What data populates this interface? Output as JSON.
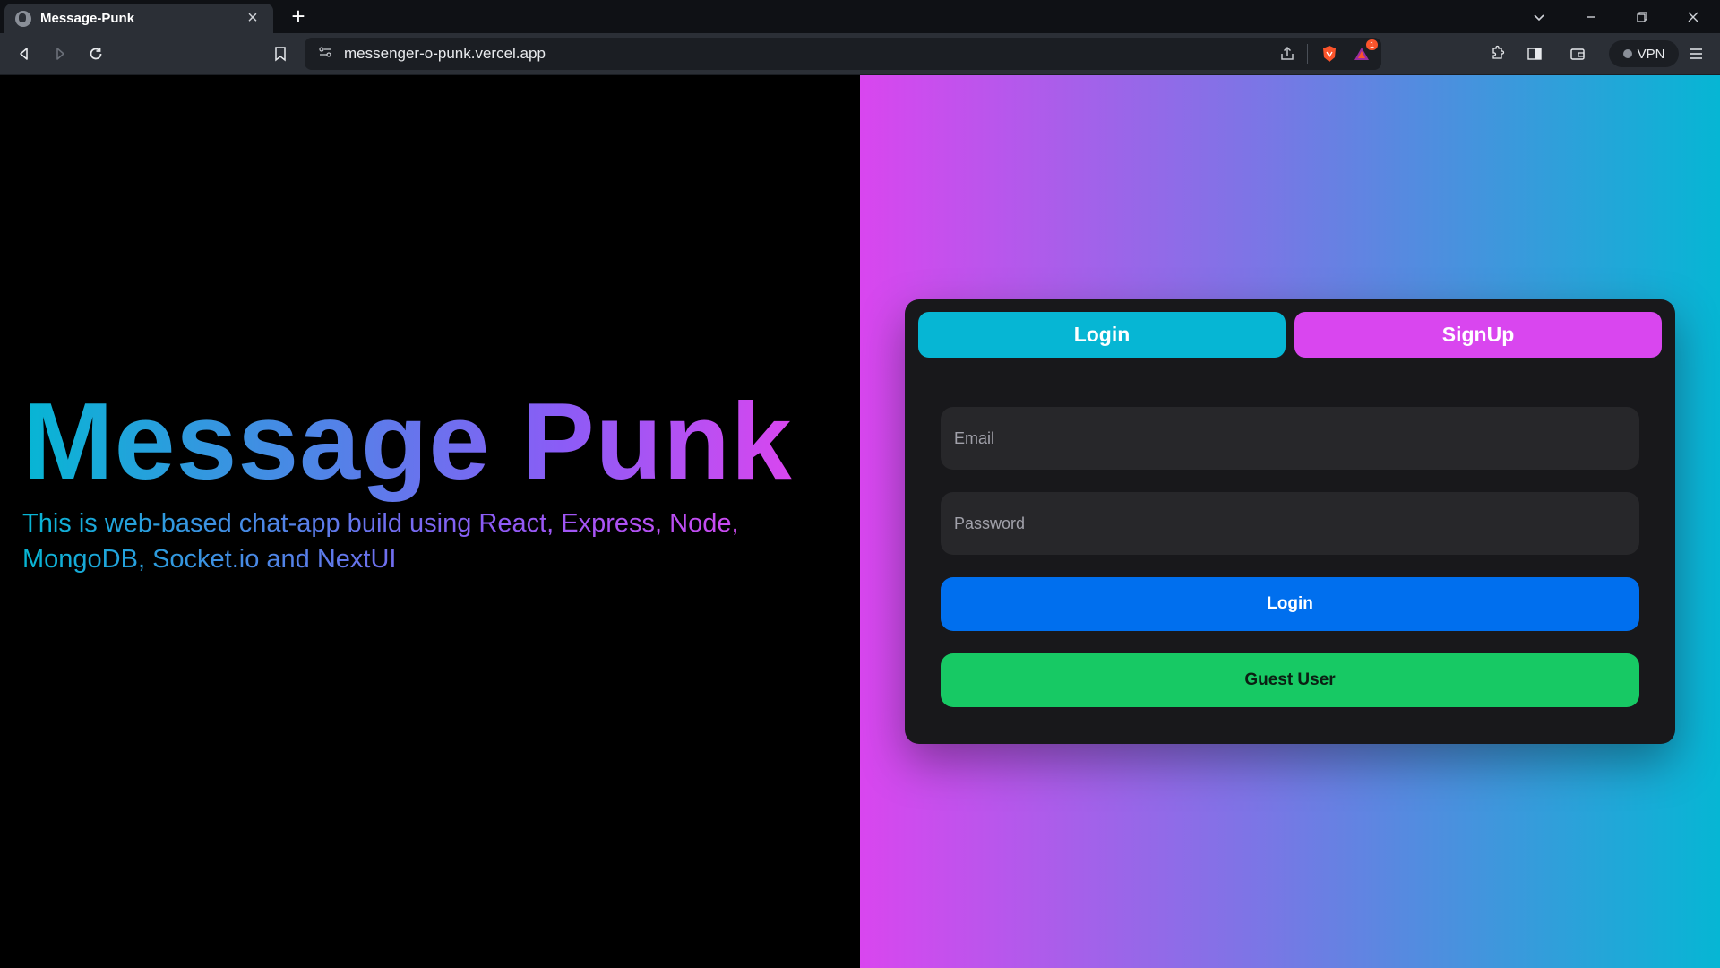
{
  "browser": {
    "tab_title": "Message-Punk",
    "url": "messenger-o-punk.vercel.app",
    "vpn_label": "VPN",
    "shields_badge": "1"
  },
  "hero": {
    "title": "Message Punk",
    "subtitle": "This is web-based chat-app build using React, Express, Node, MongoDB, Socket.io and NextUI"
  },
  "auth": {
    "tabs": {
      "login": "Login",
      "signup": "SignUp"
    },
    "email_placeholder": "Email",
    "password_placeholder": "Password",
    "login_button": "Login",
    "guest_button": "Guest User"
  },
  "colors": {
    "tab_login": "#06b6d4",
    "tab_signup": "#d946ef",
    "primary_button": "#006fee",
    "guest_button": "#17c964",
    "card": "#18181b"
  }
}
